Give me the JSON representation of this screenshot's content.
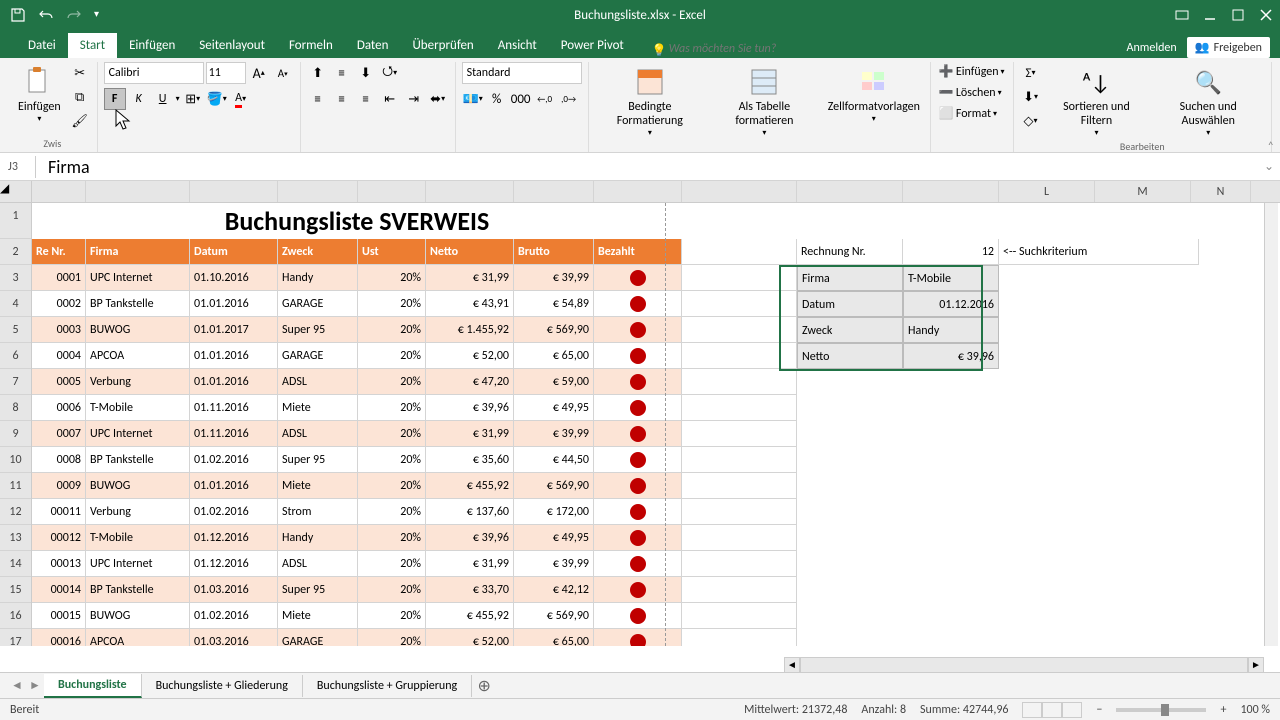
{
  "app": {
    "title": "Buchungsliste.xlsx - Excel"
  },
  "tabs": {
    "datei": "Datei",
    "start": "Start",
    "einfuegen": "Einfügen",
    "seitenlayout": "Seitenlayout",
    "formeln": "Formeln",
    "daten": "Daten",
    "ueberpruefen": "Überprüfen",
    "ansicht": "Ansicht",
    "powerpivot": "Power Pivot"
  },
  "tellme": "Was möchten Sie tun?",
  "account": {
    "signin": "Anmelden",
    "share": "Freigeben"
  },
  "ribbon": {
    "clipboard": {
      "paste": "Einfügen",
      "group": "Zwis"
    },
    "font": {
      "name": "Calibri",
      "size": "11"
    },
    "number": {
      "format": "Standard"
    },
    "styles": {
      "cond": "Bedingte Formatierung",
      "table": "Als Tabelle formatieren",
      "cellstyle": "Zellformatvorlagen"
    },
    "cells": {
      "insert": "Einfügen",
      "delete": "Löschen",
      "format": "Format"
    },
    "editing": {
      "sort": "Sortieren und Filtern",
      "find": "Suchen und Auswählen",
      "group": "Bearbeiten"
    }
  },
  "namebox": "J3",
  "formula": "Firma",
  "sheet": {
    "title": "Buchungsliste SVERWEIS",
    "headers": {
      "renr": "Re Nr.",
      "firma": "Firma",
      "datum": "Datum",
      "zweck": "Zweck",
      "ust": "Ust",
      "netto": "Netto",
      "brutto": "Brutto",
      "bezahlt": "Bezahlt"
    },
    "rows": [
      {
        "nr": "0001",
        "firma": "UPC Internet",
        "datum": "01.10.2016",
        "zweck": "Handy",
        "ust": "20%",
        "netto": "€       31,99",
        "brutto": "€ 39,99"
      },
      {
        "nr": "0002",
        "firma": "BP Tankstelle",
        "datum": "01.01.2016",
        "zweck": "GARAGE",
        "ust": "20%",
        "netto": "€       43,91",
        "brutto": "€ 54,89"
      },
      {
        "nr": "0003",
        "firma": "BUWOG",
        "datum": "01.01.2017",
        "zweck": "Super 95",
        "ust": "20%",
        "netto": "€  1.455,92",
        "brutto": "€ 569,90"
      },
      {
        "nr": "0004",
        "firma": "APCOA",
        "datum": "01.01.2016",
        "zweck": "GARAGE",
        "ust": "20%",
        "netto": "€       52,00",
        "brutto": "€ 65,00"
      },
      {
        "nr": "0005",
        "firma": "Verbung",
        "datum": "01.01.2016",
        "zweck": "ADSL",
        "ust": "20%",
        "netto": "€       47,20",
        "brutto": "€ 59,00"
      },
      {
        "nr": "0006",
        "firma": "T-Mobile",
        "datum": "01.11.2016",
        "zweck": "Miete",
        "ust": "20%",
        "netto": "€       39,96",
        "brutto": "€ 49,95"
      },
      {
        "nr": "0007",
        "firma": "UPC Internet",
        "datum": "01.11.2016",
        "zweck": "ADSL",
        "ust": "20%",
        "netto": "€       31,99",
        "brutto": "€ 39,99"
      },
      {
        "nr": "0008",
        "firma": "BP Tankstelle",
        "datum": "01.02.2016",
        "zweck": "Super 95",
        "ust": "20%",
        "netto": "€       35,60",
        "brutto": "€ 44,50"
      },
      {
        "nr": "0009",
        "firma": "BUWOG",
        "datum": "01.01.2016",
        "zweck": "Miete",
        "ust": "20%",
        "netto": "€     455,92",
        "brutto": "€ 569,90"
      },
      {
        "nr": "00011",
        "firma": "Verbung",
        "datum": "01.02.2016",
        "zweck": "Strom",
        "ust": "20%",
        "netto": "€     137,60",
        "brutto": "€ 172,00"
      },
      {
        "nr": "00012",
        "firma": "T-Mobile",
        "datum": "01.12.2016",
        "zweck": "Handy",
        "ust": "20%",
        "netto": "€       39,96",
        "brutto": "€ 49,95"
      },
      {
        "nr": "00013",
        "firma": "UPC Internet",
        "datum": "01.12.2016",
        "zweck": "ADSL",
        "ust": "20%",
        "netto": "€       31,99",
        "brutto": "€ 39,99"
      },
      {
        "nr": "00014",
        "firma": "BP Tankstelle",
        "datum": "01.03.2016",
        "zweck": "Super 95",
        "ust": "20%",
        "netto": "€       33,70",
        "brutto": "€ 42,12"
      },
      {
        "nr": "00015",
        "firma": "BUWOG",
        "datum": "01.02.2016",
        "zweck": "Miete",
        "ust": "20%",
        "netto": "€     455,92",
        "brutto": "€ 569,90"
      },
      {
        "nr": "00016",
        "firma": "APCOA",
        "datum": "01.03.2016",
        "zweck": "GARAGE",
        "ust": "20%",
        "netto": "€       52,00",
        "brutto": "€ 65,00"
      }
    ],
    "lookup": {
      "label_rechnung": "Rechnung Nr.",
      "val_rechnung": "12",
      "hint": "<-- Suchkriterium",
      "firma_l": "Firma",
      "firma_v": "T-Mobile",
      "datum_l": "Datum",
      "datum_v": "01.12.2016",
      "zweck_l": "Zweck",
      "zweck_v": "Handy",
      "netto_l": "Netto",
      "netto_v": "€ 39,96"
    }
  },
  "sheets": {
    "s1": "Buchungsliste",
    "s2": "Buchungsliste + Gliederung",
    "s3": "Buchungsliste + Gruppierung"
  },
  "status": {
    "ready": "Bereit",
    "mittelwert": "Mittelwert: 21372,48",
    "anzahl": "Anzahl: 8",
    "summe": "Summe: 42744,96",
    "zoom": "100 %"
  }
}
